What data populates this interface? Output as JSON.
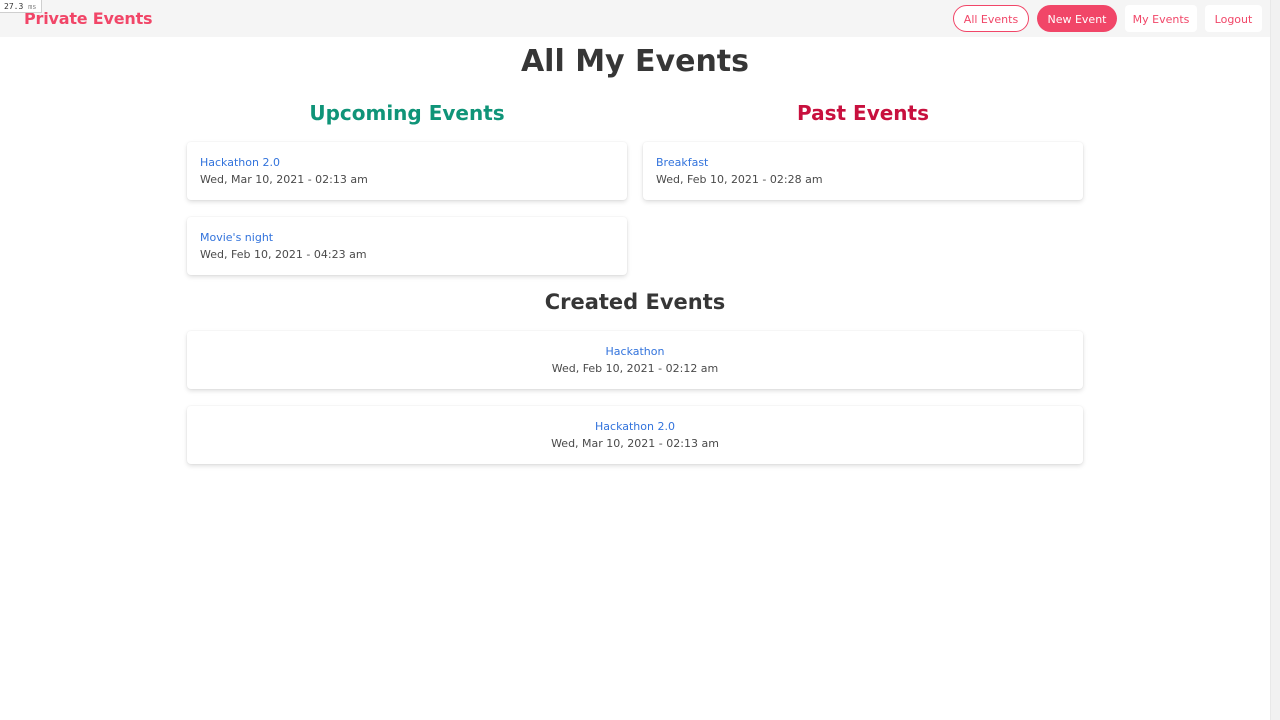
{
  "timing": {
    "value": "27.3",
    "unit": "ms"
  },
  "nav": {
    "brand": "Private Events",
    "buttons": [
      "All Events",
      "New Event",
      "My Events",
      "Logout"
    ]
  },
  "page": {
    "title": "All My Events",
    "upcoming_title": "Upcoming Events",
    "past_title": "Past Events",
    "created_title": "Created Events"
  },
  "upcoming": [
    {
      "name": "Hackathon 2.0",
      "date": "Wed, Mar 10, 2021 - 02:13 am"
    },
    {
      "name": "Movie's night",
      "date": "Wed, Feb 10, 2021 - 04:23 am"
    }
  ],
  "past": [
    {
      "name": "Breakfast",
      "date": "Wed, Feb 10, 2021 - 02:28 am"
    }
  ],
  "created": [
    {
      "name": "Hackathon",
      "date": "Wed, Feb 10, 2021 - 02:12 am"
    },
    {
      "name": "Hackathon 2.0",
      "date": "Wed, Mar 10, 2021 - 02:13 am"
    }
  ],
  "colors": {
    "accent": "#f14668",
    "upcoming": "#0f9478",
    "past": "#c8103e",
    "link": "#3273dc"
  }
}
